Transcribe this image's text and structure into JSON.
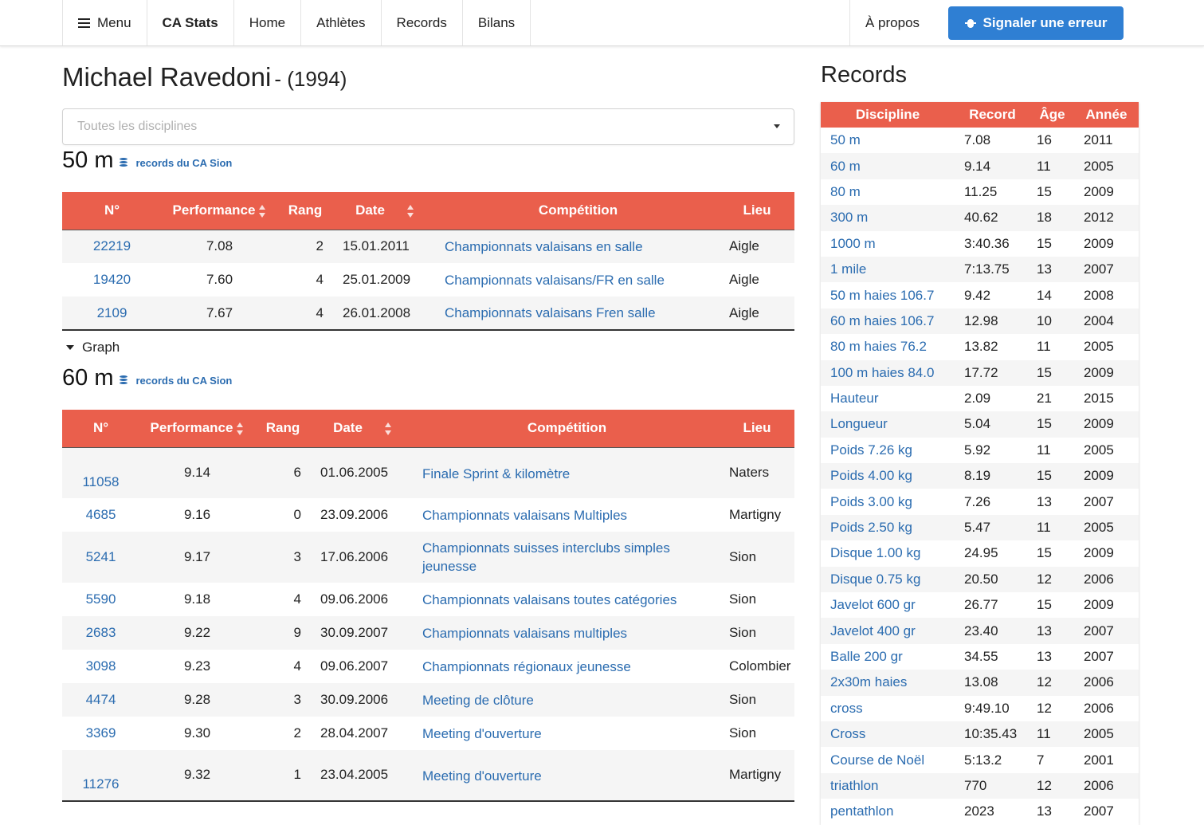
{
  "nav": {
    "menu_label": "Menu",
    "brand": "CA Stats",
    "items": [
      "Home",
      "Athlètes",
      "Records",
      "Bilans"
    ],
    "about": "À propos",
    "report_button": "Signaler une erreur"
  },
  "athlete": {
    "name": "Michael Ravedoni",
    "year": "- (1994)"
  },
  "filter": {
    "placeholder": "Toutes les disciplines"
  },
  "colors": {
    "accent": "#ea5f4c",
    "link": "#2b6cb0",
    "button": "#2f7fd3"
  },
  "performance_headers": [
    "N°",
    "Performance",
    "Rang",
    "Date",
    "Compétition",
    "Lieu"
  ],
  "graph_label": "Graph",
  "disciplines": [
    {
      "name": "50 m",
      "records_link": "records du CA Sion",
      "rows": [
        {
          "num": "22219",
          "perf": "7.08",
          "rank": "2",
          "date": "15.01.2011",
          "comp": "Championnats valaisans en salle",
          "place": "Aigle"
        },
        {
          "num": "19420",
          "perf": "7.60",
          "rank": "4",
          "date": "25.01.2009",
          "comp": "Championnats valaisans/FR en salle",
          "place": "Aigle"
        },
        {
          "num": "2109",
          "perf": "7.67",
          "rank": "4",
          "date": "26.01.2008",
          "comp": "Championnats valaisans Fren salle",
          "place": "Aigle"
        }
      ]
    },
    {
      "name": "60 m",
      "records_link": "records du CA Sion",
      "rows": [
        {
          "num": "11058",
          "perf": "9.14",
          "rank": "6",
          "date": "01.06.2005",
          "comp": "Finale Sprint & kilomètre",
          "place": "Naters"
        },
        {
          "num": "4685",
          "perf": "9.16",
          "rank": "0",
          "date": "23.09.2006",
          "comp": "Championnats valaisans Multiples",
          "place": "Martigny"
        },
        {
          "num": "5241",
          "perf": "9.17",
          "rank": "3",
          "date": "17.06.2006",
          "comp": "Championnats suisses interclubs simples jeunesse",
          "place": "Sion"
        },
        {
          "num": "5590",
          "perf": "9.18",
          "rank": "4",
          "date": "09.06.2006",
          "comp": "Championnats valaisans toutes catégories",
          "place": "Sion"
        },
        {
          "num": "2683",
          "perf": "9.22",
          "rank": "9",
          "date": "30.09.2007",
          "comp": "Championnats valaisans multiples",
          "place": "Sion"
        },
        {
          "num": "3098",
          "perf": "9.23",
          "rank": "4",
          "date": "09.06.2007",
          "comp": "Championnats régionaux jeunesse",
          "place": "Colombier"
        },
        {
          "num": "4474",
          "perf": "9.28",
          "rank": "3",
          "date": "30.09.2006",
          "comp": "Meeting de clôture",
          "place": "Sion"
        },
        {
          "num": "3369",
          "perf": "9.30",
          "rank": "2",
          "date": "28.04.2007",
          "comp": "Meeting d'ouverture",
          "place": "Sion"
        },
        {
          "num": "11276",
          "perf": "9.32",
          "rank": "1",
          "date": "23.04.2005",
          "comp": "Meeting d'ouverture",
          "place": "Martigny"
        }
      ]
    }
  ],
  "records": {
    "title": "Records",
    "headers": [
      "Discipline",
      "Record",
      "Âge",
      "Année"
    ],
    "rows": [
      {
        "d": "50 m",
        "r": "7.08",
        "a": "16",
        "y": "2011"
      },
      {
        "d": "60 m",
        "r": "9.14",
        "a": "11",
        "y": "2005"
      },
      {
        "d": "80 m",
        "r": "11.25",
        "a": "15",
        "y": "2009"
      },
      {
        "d": "300 m",
        "r": "40.62",
        "a": "18",
        "y": "2012"
      },
      {
        "d": "1000 m",
        "r": "3:40.36",
        "a": "15",
        "y": "2009"
      },
      {
        "d": "1 mile",
        "r": "7:13.75",
        "a": "13",
        "y": "2007"
      },
      {
        "d": "50 m haies 106.7",
        "r": "9.42",
        "a": "14",
        "y": "2008"
      },
      {
        "d": "60 m haies 106.7",
        "r": "12.98",
        "a": "10",
        "y": "2004"
      },
      {
        "d": "80 m haies 76.2",
        "r": "13.82",
        "a": "11",
        "y": "2005"
      },
      {
        "d": "100 m haies 84.0",
        "r": "17.72",
        "a": "15",
        "y": "2009"
      },
      {
        "d": "Hauteur",
        "r": "2.09",
        "a": "21",
        "y": "2015"
      },
      {
        "d": "Longueur",
        "r": "5.04",
        "a": "15",
        "y": "2009"
      },
      {
        "d": "Poids 7.26 kg",
        "r": "5.92",
        "a": "11",
        "y": "2005"
      },
      {
        "d": "Poids 4.00 kg",
        "r": "8.19",
        "a": "15",
        "y": "2009"
      },
      {
        "d": "Poids 3.00 kg",
        "r": "7.26",
        "a": "13",
        "y": "2007"
      },
      {
        "d": "Poids 2.50 kg",
        "r": "5.47",
        "a": "11",
        "y": "2005"
      },
      {
        "d": "Disque 1.00 kg",
        "r": "24.95",
        "a": "15",
        "y": "2009"
      },
      {
        "d": "Disque 0.75 kg",
        "r": "20.50",
        "a": "12",
        "y": "2006"
      },
      {
        "d": "Javelot 600 gr",
        "r": "26.77",
        "a": "15",
        "y": "2009"
      },
      {
        "d": "Javelot 400 gr",
        "r": "23.40",
        "a": "13",
        "y": "2007"
      },
      {
        "d": "Balle 200 gr",
        "r": "34.55",
        "a": "13",
        "y": "2007"
      },
      {
        "d": "2x30m haies",
        "r": "13.08",
        "a": "12",
        "y": "2006"
      },
      {
        "d": "cross",
        "r": "9:49.10",
        "a": "12",
        "y": "2006"
      },
      {
        "d": "Cross",
        "r": "10:35.43",
        "a": "11",
        "y": "2005"
      },
      {
        "d": "Course de Noël",
        "r": "5:13.2",
        "a": "7",
        "y": "2001"
      },
      {
        "d": "triathlon",
        "r": "770",
        "a": "12",
        "y": "2006"
      },
      {
        "d": "pentathlon",
        "r": "2023",
        "a": "13",
        "y": "2007"
      }
    ]
  }
}
